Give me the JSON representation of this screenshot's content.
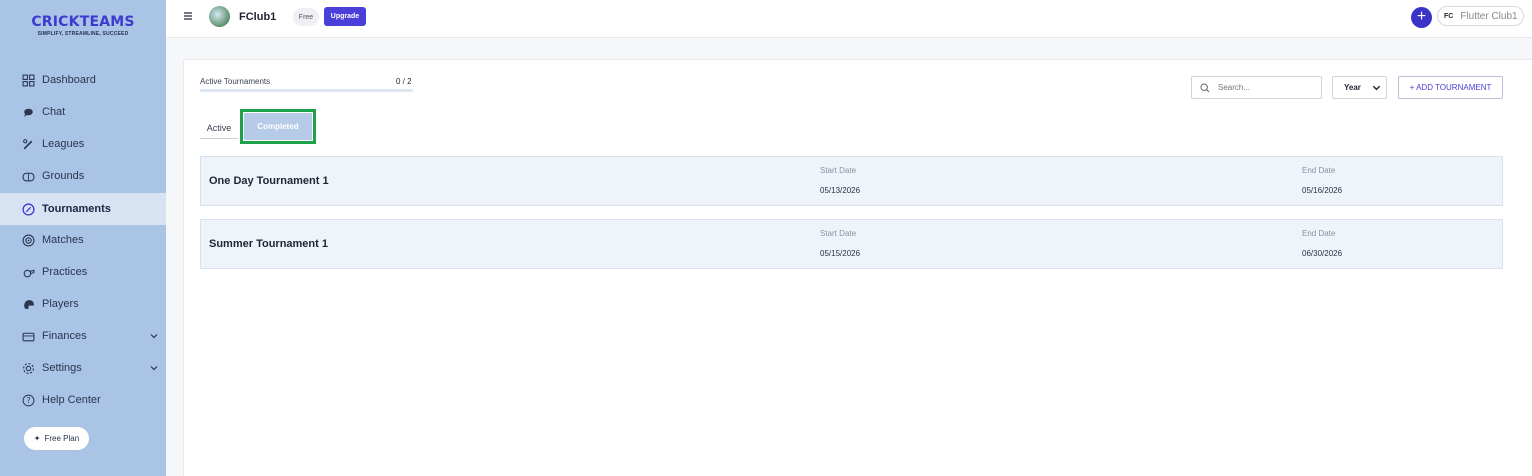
{
  "brand": {
    "name": "CRICKTEAMS",
    "tagline": "SIMPLIFY, STREAMLINE, SUCCEED"
  },
  "sidebar": {
    "items": [
      {
        "label": "Dashboard",
        "icon": "grid-icon"
      },
      {
        "label": "Chat",
        "icon": "chat-bubble-icon"
      },
      {
        "label": "Leagues",
        "icon": "bat-ball-icon"
      },
      {
        "label": "Grounds",
        "icon": "ground-icon"
      },
      {
        "label": "Tournaments",
        "icon": "compass-icon",
        "active": true
      },
      {
        "label": "Matches",
        "icon": "target-icon"
      },
      {
        "label": "Practices",
        "icon": "whistle-icon"
      },
      {
        "label": "Players",
        "icon": "helmet-icon"
      },
      {
        "label": "Finances",
        "icon": "wallet-icon",
        "expandable": true
      },
      {
        "label": "Settings",
        "icon": "gear-icon",
        "expandable": true
      },
      {
        "label": "Help Center",
        "icon": "help-circle-icon"
      }
    ],
    "free_plan_label": "Free Plan"
  },
  "header": {
    "club_name": "FClub1",
    "plan_badge": "Free",
    "upgrade_label": "Upgrade",
    "add_label": "+",
    "account_initials": "FC",
    "account_name": "Flutter Club1"
  },
  "main": {
    "active_tournaments_label": "Active Tournaments",
    "active_tournaments_count": "0 / 2",
    "active_tournaments_fraction": 0,
    "tabs": {
      "active": "Active",
      "completed": "Completed"
    },
    "search_placeholder": "Search...",
    "year_label": "Year",
    "add_tournament_label": "+ ADD TOURNAMENT",
    "tournaments": [
      {
        "name": "One Day Tournament 1",
        "start_label": "Start Date",
        "start": "05/13/2026",
        "end_label": "End Date",
        "end": "05/16/2026"
      },
      {
        "name": "Summer Tournament 1",
        "start_label": "Start Date",
        "start": "05/15/2026",
        "end_label": "End Date",
        "end": "06/30/2026"
      }
    ]
  },
  "colors": {
    "sidebar_bg": "#a9c4e4",
    "accent": "#4a3fd8",
    "highlight_frame": "#1ea34a"
  }
}
